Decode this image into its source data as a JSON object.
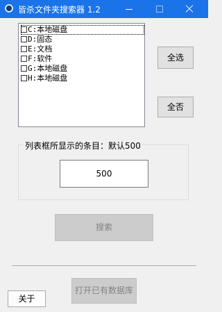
{
  "window": {
    "title": "皆杀文件夹搜索器 1.2",
    "accent": "#1a73e8"
  },
  "drives": {
    "items": [
      {
        "label": "C:本地磁盘",
        "checked": false
      },
      {
        "label": "D:固态",
        "checked": false
      },
      {
        "label": "E:文档",
        "checked": false
      },
      {
        "label": "F:软件",
        "checked": false
      },
      {
        "label": "G:本地磁盘",
        "checked": false
      },
      {
        "label": "H:本地磁盘",
        "checked": false
      }
    ]
  },
  "buttons": {
    "select_all": "全选",
    "select_none": "全否",
    "search": "搜索",
    "about": "关于",
    "open_db": "打开已有数据库"
  },
  "listcount": {
    "label": "列表框所显示的条目：默认500",
    "value": "500"
  }
}
